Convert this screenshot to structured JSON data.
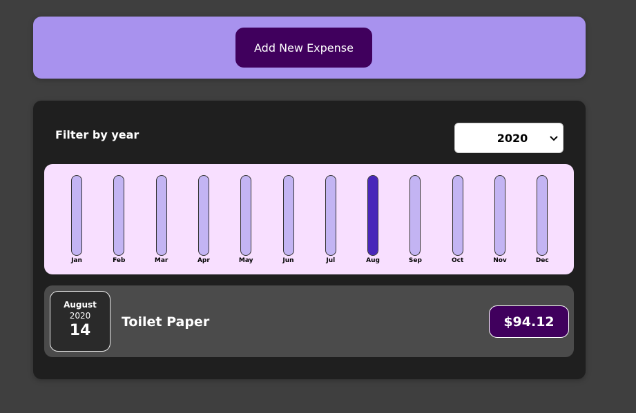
{
  "new_expense": {
    "button_label": "Add New Expense"
  },
  "filter": {
    "label": "Filter by year",
    "selected_year": "2020"
  },
  "chart_data": {
    "type": "bar",
    "categories": [
      "Jan",
      "Feb",
      "Mar",
      "Apr",
      "May",
      "Jun",
      "Jul",
      "Aug",
      "Sep",
      "Oct",
      "Nov",
      "Dec"
    ],
    "values": [
      0,
      0,
      0,
      0,
      0,
      0,
      0,
      94.12,
      0,
      0,
      0,
      0
    ],
    "max_value": 94.12,
    "bar_color": "#4826b9",
    "bar_track_color": "#c3b4f3"
  },
  "expense_item": {
    "month": "August",
    "year": "2020",
    "day": "14",
    "title": "Toilet Paper",
    "amount": "$94.12"
  },
  "colors": {
    "background": "#3f3f3f",
    "new_expense_panel": "#a892ee",
    "button": "#40005d",
    "expenses_panel": "#1f1f1f",
    "chart_bg": "#f8dfff",
    "item_bg": "#4b4b4b"
  }
}
